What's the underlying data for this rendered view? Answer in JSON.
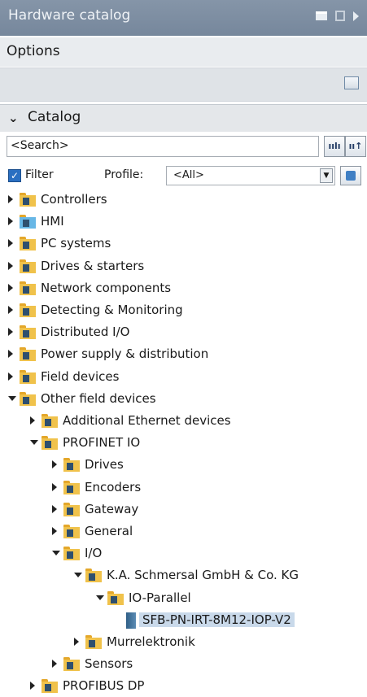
{
  "panel": {
    "title": "Hardware catalog"
  },
  "options": {
    "label": "Options"
  },
  "catalog": {
    "label": "Catalog",
    "search": {
      "value": "<Search>"
    },
    "filter": {
      "label": "Filter",
      "checked": true
    },
    "profile": {
      "label": "Profile:",
      "value": "<All>"
    }
  },
  "tree": [
    {
      "label": "Controllers",
      "state": "collapsed",
      "level": 0
    },
    {
      "label": "HMI",
      "state": "collapsed",
      "level": 0
    },
    {
      "label": "PC systems",
      "state": "collapsed",
      "level": 0
    },
    {
      "label": "Drives & starters",
      "state": "collapsed",
      "level": 0
    },
    {
      "label": "Network components",
      "state": "collapsed",
      "level": 0
    },
    {
      "label": "Detecting & Monitoring",
      "state": "collapsed",
      "level": 0
    },
    {
      "label": "Distributed I/O",
      "state": "collapsed",
      "level": 0
    },
    {
      "label": "Power supply & distribution",
      "state": "collapsed",
      "level": 0
    },
    {
      "label": "Field devices",
      "state": "collapsed",
      "level": 0
    },
    {
      "label": "Other field devices",
      "state": "expanded",
      "level": 0
    },
    {
      "label": "Additional Ethernet devices",
      "state": "collapsed",
      "level": 1
    },
    {
      "label": "PROFINET IO",
      "state": "expanded",
      "level": 1
    },
    {
      "label": "Drives",
      "state": "collapsed",
      "level": 2
    },
    {
      "label": "Encoders",
      "state": "collapsed",
      "level": 2
    },
    {
      "label": "Gateway",
      "state": "collapsed",
      "level": 2
    },
    {
      "label": "General",
      "state": "collapsed",
      "level": 2
    },
    {
      "label": "I/O",
      "state": "expanded",
      "level": 2
    },
    {
      "label": "K.A. Schmersal GmbH & Co. KG",
      "state": "expanded",
      "level": 3
    },
    {
      "label": "IO-Parallel",
      "state": "expanded",
      "level": 4
    },
    {
      "label": "SFB-PN-IRT-8M12-IOP-V2",
      "state": "device",
      "level": 5,
      "selected": true
    },
    {
      "label": "Murrelektronik",
      "state": "collapsed",
      "level": 3
    },
    {
      "label": "Sensors",
      "state": "collapsed",
      "level": 2
    },
    {
      "label": "PROFIBUS DP",
      "state": "collapsed",
      "level": 1
    }
  ]
}
